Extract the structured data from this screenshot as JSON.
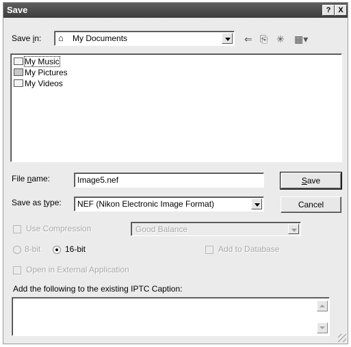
{
  "window": {
    "title": "Save",
    "help_glyph": "?",
    "close_glyph": "X"
  },
  "save_in": {
    "label_prefix": "Save ",
    "label_accel": "i",
    "label_suffix": "n:",
    "value": "My Documents",
    "icon": "my-documents-icon"
  },
  "toolbar": {
    "back_glyph": "⇐",
    "up_glyph": "⎘",
    "new_folder_glyph": "✳",
    "views_glyph": "▦▾"
  },
  "files": [
    {
      "name": "My Music",
      "icon": "folder-icon"
    },
    {
      "name": "My Pictures",
      "icon": "folder-pictures-icon"
    },
    {
      "name": "My Videos",
      "icon": "folder-icon"
    }
  ],
  "file_name": {
    "label_prefix": "File ",
    "label_accel": "n",
    "label_suffix": "ame:",
    "value": "Image5.nef"
  },
  "save_as_type": {
    "label_prefix": "Save as ",
    "label_accel": "t",
    "label_suffix": "ype:",
    "value": "NEF (Nikon Electronic Image Format)"
  },
  "buttons": {
    "save_accel": "S",
    "save_rest": "ave",
    "cancel": "Cancel"
  },
  "options": {
    "use_compression": "Use Compression",
    "compression_value": "Good Balance",
    "bit8": "8-bit",
    "bit16": "16-bit",
    "add_to_database": "Add to Database",
    "open_external": "Open in External Application",
    "iptc_caption_label": "Add the following to the existing IPTC Caption:"
  },
  "state": {
    "selected_bit_depth": "16-bit"
  }
}
